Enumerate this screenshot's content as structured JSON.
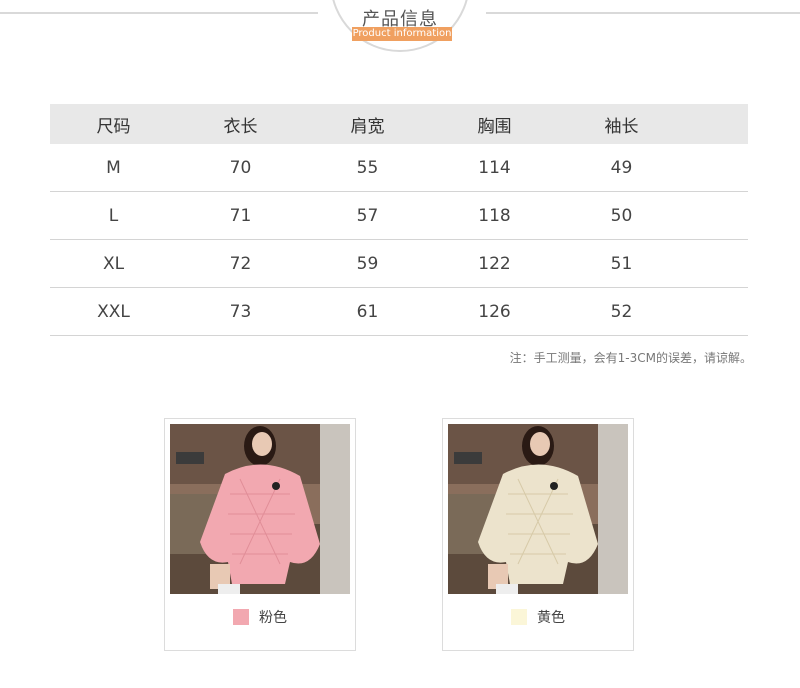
{
  "header": {
    "title": "产品信息",
    "subtitle": "Product information"
  },
  "size_table": {
    "headers": [
      "尺码",
      "衣长",
      "肩宽",
      "胸围",
      "袖长"
    ],
    "rows": [
      [
        "M",
        "70",
        "55",
        "114",
        "49"
      ],
      [
        "L",
        "71",
        "57",
        "118",
        "50"
      ],
      [
        "XL",
        "72",
        "59",
        "122",
        "51"
      ],
      [
        "XXL",
        "73",
        "61",
        "126",
        "52"
      ]
    ],
    "note": "注：手工测量，会有1-3CM的误差，请谅解。"
  },
  "products": [
    {
      "color_name": "粉色",
      "swatch": "#f2a8b0"
    },
    {
      "color_name": "黄色",
      "swatch": "#fbf6d8"
    }
  ]
}
